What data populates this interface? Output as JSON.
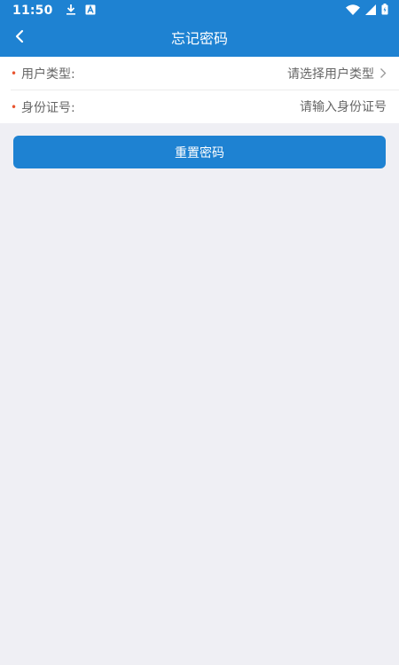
{
  "status_bar": {
    "time": "11:50",
    "icons": [
      "download-icon",
      "a-notification-icon",
      "wifi-icon",
      "signal-icon",
      "battery-icon"
    ]
  },
  "nav": {
    "title": "忘记密码",
    "back_icon": "chevron-left-icon"
  },
  "form": {
    "user_type": {
      "required": "•",
      "label": "用户类型:",
      "value": "请选择用户类型",
      "icon": "chevron-right-icon"
    },
    "id_number": {
      "required": "•",
      "label": "身份证号:",
      "placeholder": "请输入身份证号"
    }
  },
  "actions": {
    "reset_label": "重置密码"
  },
  "colors": {
    "primary": "#1e82d2",
    "required": "#e8542f",
    "background": "#efeff4"
  }
}
